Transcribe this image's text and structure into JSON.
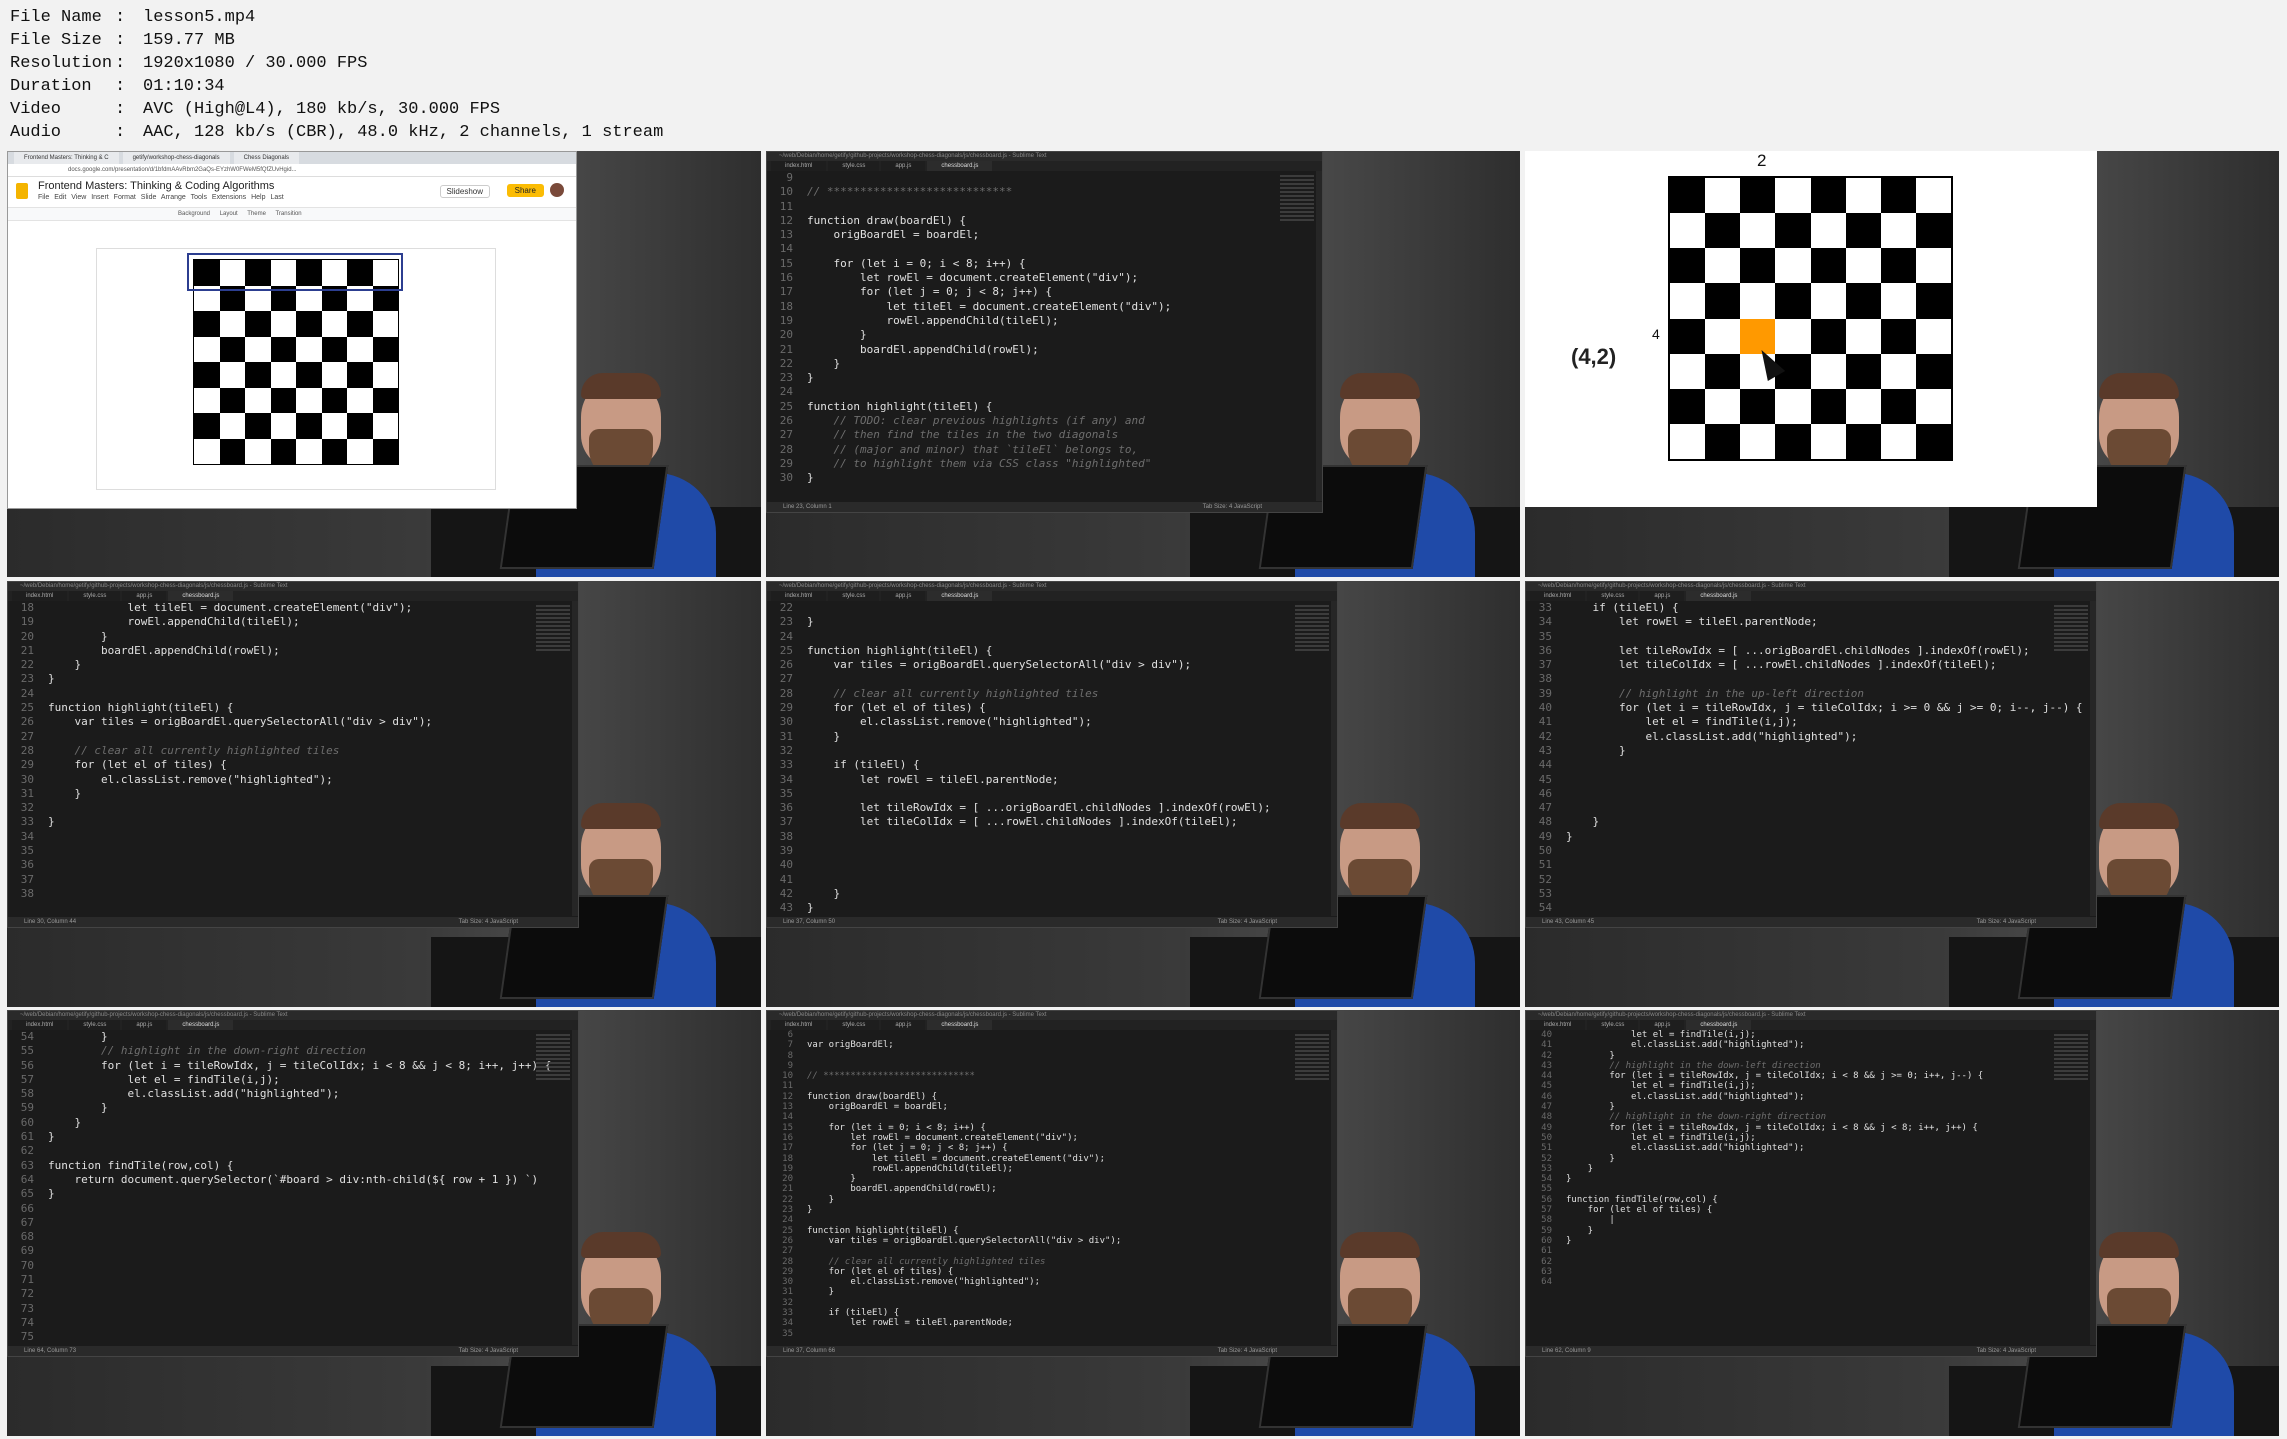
{
  "info": [
    {
      "key": "File Name",
      "value": "lesson5.mp4"
    },
    {
      "key": "File Size",
      "value": "159.77 MB"
    },
    {
      "key": "Resolution",
      "value": "1920x1080 / 30.000 FPS"
    },
    {
      "key": "Duration",
      "value": "01:10:34"
    },
    {
      "key": "Video",
      "value": "AVC (High@L4), 180 kb/s, 30.000 FPS"
    },
    {
      "key": "Audio",
      "value": "AAC, 128 kb/s (CBR), 48.0 kHz, 2 channels, 1 stream"
    }
  ],
  "separator": ":",
  "slides": {
    "tabs": [
      "Frontend Masters: Thinking & C",
      "getify/workshop-chess-diagonals",
      "Chess Diagonals"
    ],
    "url": "docs.google.com/presentation/d/1bfdmAAvRbm2GaQs-EYzhW0FWeM5fQfZUvHgid...",
    "title": "Frontend Masters: Thinking & Coding Algorithms",
    "menu": "File Edit View Insert Format Slide Arrange Tools Extensions Help Last",
    "slideshow": "Slideshow",
    "share": "Share",
    "toolbar": "Background Layout Theme Transition"
  },
  "big_slide": {
    "top_label": "2",
    "left_label": "4",
    "coord": "(4,2)"
  },
  "editor": {
    "title": "~/web/Debian/home/getify/github-projects/workshop-chess-diagonals/js/chessboard.js - Sublime Text",
    "tabs": [
      "index.html",
      "style.css",
      "app.js",
      "chessboard.js"
    ],
    "status_right": "Tab Size: 4     JavaScript"
  },
  "frames": {
    "f2": {
      "status": "Line 23, Column 1",
      "gutter": [
        "9",
        "10",
        "11",
        "12",
        "13",
        "14",
        "15",
        "16",
        "17",
        "18",
        "19",
        "20",
        "21",
        "22",
        "23",
        "24",
        "25",
        "26",
        "27",
        "28",
        "29",
        "30"
      ],
      "lines": [
        "",
        "// ****************************",
        "",
        "function draw(boardEl) {",
        "    origBoardEl = boardEl;",
        "",
        "    for (let i = 0; i < 8; i++) {",
        "        let rowEl = document.createElement(\"div\");",
        "        for (let j = 0; j < 8; j++) {",
        "            let tileEl = document.createElement(\"div\");",
        "            rowEl.appendChild(tileEl);",
        "        }",
        "        boardEl.appendChild(rowEl);",
        "    }",
        "}",
        "",
        "function highlight(tileEl) {",
        "    // TODO: clear previous highlights (if any) and",
        "    // then find the tiles in the two diagonals",
        "    // (major and minor) that `tileEl` belongs to,",
        "    // to highlight them via CSS class \"highlighted\"",
        "}"
      ]
    },
    "f4": {
      "status": "Line 30, Column 44",
      "gutter": [
        "18",
        "19",
        "20",
        "21",
        "22",
        "23",
        "24",
        "25",
        "26",
        "27",
        "28",
        "29",
        "30",
        "31",
        "32",
        "33",
        "34",
        "35",
        "36",
        "37",
        "38"
      ],
      "lines": [
        "            let tileEl = document.createElement(\"div\");",
        "            rowEl.appendChild(tileEl);",
        "        }",
        "        boardEl.appendChild(rowEl);",
        "    }",
        "}",
        "",
        "function highlight(tileEl) {",
        "    var tiles = origBoardEl.querySelectorAll(\"div > div\");",
        "",
        "    // clear all currently highlighted tiles",
        "    for (let el of tiles) {",
        "        el.classList.remove(\"highlighted\");",
        "    }",
        "",
        "}",
        "",
        "",
        "",
        "",
        ""
      ]
    },
    "f5": {
      "status": "Line 37, Column 50",
      "gutter": [
        "22",
        "23",
        "24",
        "25",
        "26",
        "27",
        "28",
        "29",
        "30",
        "31",
        "32",
        "33",
        "34",
        "35",
        "36",
        "37",
        "38",
        "39",
        "40",
        "41",
        "42",
        "43"
      ],
      "lines": [
        "",
        "}",
        "",
        "function highlight(tileEl) {",
        "    var tiles = origBoardEl.querySelectorAll(\"div > div\");",
        "",
        "    // clear all currently highlighted tiles",
        "    for (let el of tiles) {",
        "        el.classList.remove(\"highlighted\");",
        "    }",
        "",
        "    if (tileEl) {",
        "        let rowEl = tileEl.parentNode;",
        "",
        "        let tileRowIdx = [ ...origBoardEl.childNodes ].indexOf(rowEl);",
        "        let tileColIdx = [ ...rowEl.childNodes ].indexOf(tileEl);",
        "",
        "",
        "",
        "",
        "    }",
        "}"
      ]
    },
    "f6": {
      "status": "Line 43, Column 45",
      "gutter": [
        "33",
        "34",
        "35",
        "36",
        "37",
        "38",
        "39",
        "40",
        "41",
        "42",
        "43",
        "44",
        "45",
        "46",
        "47",
        "48",
        "49",
        "50",
        "51",
        "52",
        "53",
        "54"
      ],
      "lines": [
        "    if (tileEl) {",
        "        let rowEl = tileEl.parentNode;",
        "",
        "        let tileRowIdx = [ ...origBoardEl.childNodes ].indexOf(rowEl);",
        "        let tileColIdx = [ ...rowEl.childNodes ].indexOf(tileEl);",
        "",
        "        // highlight in the up-left direction",
        "        for (let i = tileRowIdx, j = tileColIdx; i >= 0 && j >= 0; i--, j--) {",
        "            let el = findTile(i,j);",
        "            el.classList.add(\"highlighted\");",
        "        }",
        "",
        "",
        "",
        "",
        "    }",
        "}",
        "",
        "",
        "",
        "",
        ""
      ]
    },
    "f7": {
      "status": "Line 64, Column 73",
      "gutter": [
        "54",
        "55",
        "56",
        "57",
        "58",
        "59",
        "60",
        "61",
        "62",
        "63",
        "64",
        "65",
        "66",
        "67",
        "68",
        "69",
        "70",
        "71",
        "72",
        "73",
        "74",
        "75"
      ],
      "lines": [
        "        }",
        "        // highlight in the down-right direction",
        "        for (let i = tileRowIdx, j = tileColIdx; i < 8 && j < 8; i++, j++) {",
        "            let el = findTile(i,j);",
        "            el.classList.add(\"highlighted\");",
        "        }",
        "    }",
        "}",
        "",
        "function findTile(row,col) {",
        "    return document.querySelector(`#board > div:nth-child(${ row + 1 }) `)",
        "}",
        "",
        "",
        "",
        "",
        "",
        "",
        "",
        "",
        "",
        ""
      ]
    },
    "f8": {
      "status": "Line 37, Column 66",
      "gutter": [
        "6",
        "7",
        "8",
        "9",
        "10",
        "11",
        "12",
        "13",
        "14",
        "15",
        "16",
        "17",
        "18",
        "19",
        "20",
        "21",
        "22",
        "23",
        "24",
        "25",
        "26",
        "27",
        "28",
        "29",
        "30",
        "31",
        "32",
        "33",
        "34",
        "35"
      ],
      "lines": [
        "",
        "var origBoardEl;",
        "",
        "",
        "// ****************************",
        "",
        "function draw(boardEl) {",
        "    origBoardEl = boardEl;",
        "",
        "    for (let i = 0; i < 8; i++) {",
        "        let rowEl = document.createElement(\"div\");",
        "        for (let j = 0; j < 8; j++) {",
        "            let tileEl = document.createElement(\"div\");",
        "            rowEl.appendChild(tileEl);",
        "        }",
        "        boardEl.appendChild(rowEl);",
        "    }",
        "}",
        "",
        "function highlight(tileEl) {",
        "    var tiles = origBoardEl.querySelectorAll(\"div > div\");",
        "",
        "    // clear all currently highlighted tiles",
        "    for (let el of tiles) {",
        "        el.classList.remove(\"highlighted\");",
        "    }",
        "",
        "    if (tileEl) {",
        "        let rowEl = tileEl.parentNode;",
        ""
      ]
    },
    "f9": {
      "status": "Line 62, Column 9",
      "gutter": [
        "40",
        "41",
        "42",
        "43",
        "44",
        "45",
        "46",
        "47",
        "48",
        "49",
        "50",
        "51",
        "52",
        "53",
        "54",
        "55",
        "56",
        "57",
        "58",
        "59",
        "60",
        "61",
        "62",
        "63",
        "64"
      ],
      "lines": [
        "            let el = findTile(i,j);",
        "            el.classList.add(\"highlighted\");",
        "        }",
        "        // highlight in the down-left direction",
        "        for (let i = tileRowIdx, j = tileColIdx; i < 8 && j >= 0; i++, j--) {",
        "            let el = findTile(i,j);",
        "            el.classList.add(\"highlighted\");",
        "        }",
        "        // highlight in the down-right direction",
        "        for (let i = tileRowIdx, j = tileColIdx; i < 8 && j < 8; i++, j++) {",
        "            let el = findTile(i,j);",
        "            el.classList.add(\"highlighted\");",
        "        }",
        "    }",
        "}",
        "",
        "function findTile(row,col) {",
        "    for (let el of tiles) {",
        "        |",
        "    }",
        "}",
        "",
        "",
        "",
        ""
      ]
    }
  }
}
